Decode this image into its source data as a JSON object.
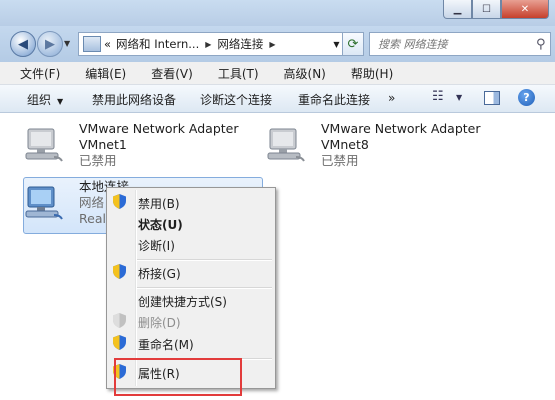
{
  "window": {
    "min_label": "▁",
    "max_label": "☐",
    "close_label": "✕"
  },
  "nav": {
    "back_glyph": "◀",
    "forward_glyph": "▶",
    "breadcrumb_prefix": "«",
    "breadcrumbs": [
      "网络和 Intern...",
      "网络连接"
    ],
    "search_placeholder": "搜索 网络连接"
  },
  "menubar": {
    "items": [
      "文件(F)",
      "编辑(E)",
      "查看(V)",
      "工具(T)",
      "高级(N)",
      "帮助(H)"
    ]
  },
  "toolbar": {
    "organize": "组织",
    "disable_device": "禁用此网络设备",
    "diagnose": "诊断这个连接",
    "rename": "重命名此连接",
    "more": "»"
  },
  "adapters": [
    {
      "name": "VMware Network Adapter",
      "device": "VMnet1",
      "status": "已禁用"
    },
    {
      "name": "VMware Network Adapter",
      "device": "VMnet8",
      "status": "已禁用"
    },
    {
      "name": "本地连接",
      "device": "网络",
      "status": "Realt"
    }
  ],
  "context_menu": {
    "items": [
      {
        "label": "禁用(B)",
        "shield": true
      },
      {
        "label": "状态(U)",
        "bold": true
      },
      {
        "label": "诊断(I)"
      },
      {
        "label": "桥接(G)",
        "shield": true
      },
      {
        "label": "创建快捷方式(S)"
      },
      {
        "label": "删除(D)",
        "shield": true,
        "disabled": true
      },
      {
        "label": "重命名(M)",
        "shield": true
      },
      {
        "label": "属性(R)",
        "shield": true
      }
    ]
  },
  "colors": {
    "highlight_box": "#e23b3b",
    "selection": "#d3e5fa"
  }
}
